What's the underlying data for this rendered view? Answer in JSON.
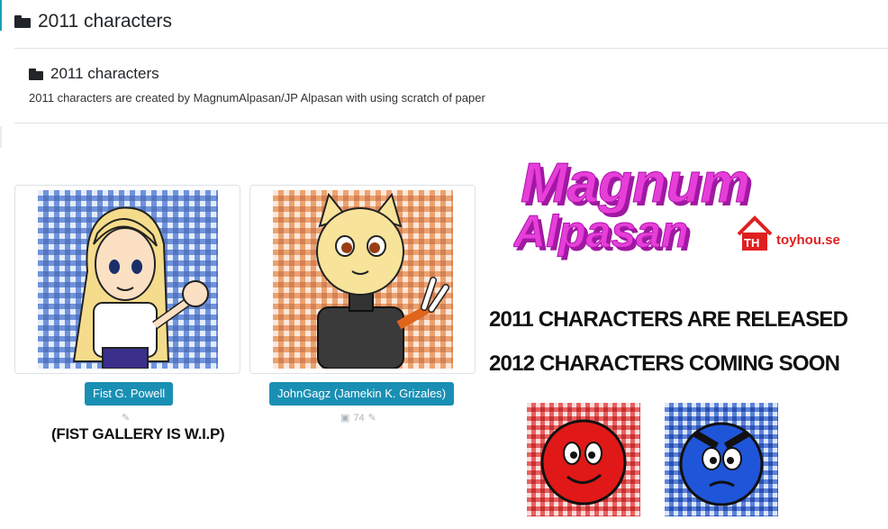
{
  "header": {
    "title": "2011 characters",
    "icon": "folder-icon"
  },
  "section": {
    "title": "2011 characters",
    "description": "2011 characters are created by MagnumAlpasan/JP Alpasan with using scratch of paper"
  },
  "characters": [
    {
      "name": "Fist G. Powell",
      "note": "(FIST GALLERY IS W.I.P)"
    },
    {
      "name": "JohnGagz (Jamekin K. Grizales)",
      "image_count": "74"
    }
  ],
  "banner": {
    "logo_line1": "Magnum",
    "logo_line2": "Alpasan",
    "th_badge": "TH",
    "site": "toyhou.se",
    "line1": "2011 CHARACTERS ARE RELEASED",
    "line2": "2012 CHARACTERS COMING SOON"
  },
  "colors": {
    "accent": "#1a8fb4",
    "logo_magenta": "#e63fd8",
    "logo_dark": "#9d1aa0",
    "th_red": "#e02020"
  }
}
